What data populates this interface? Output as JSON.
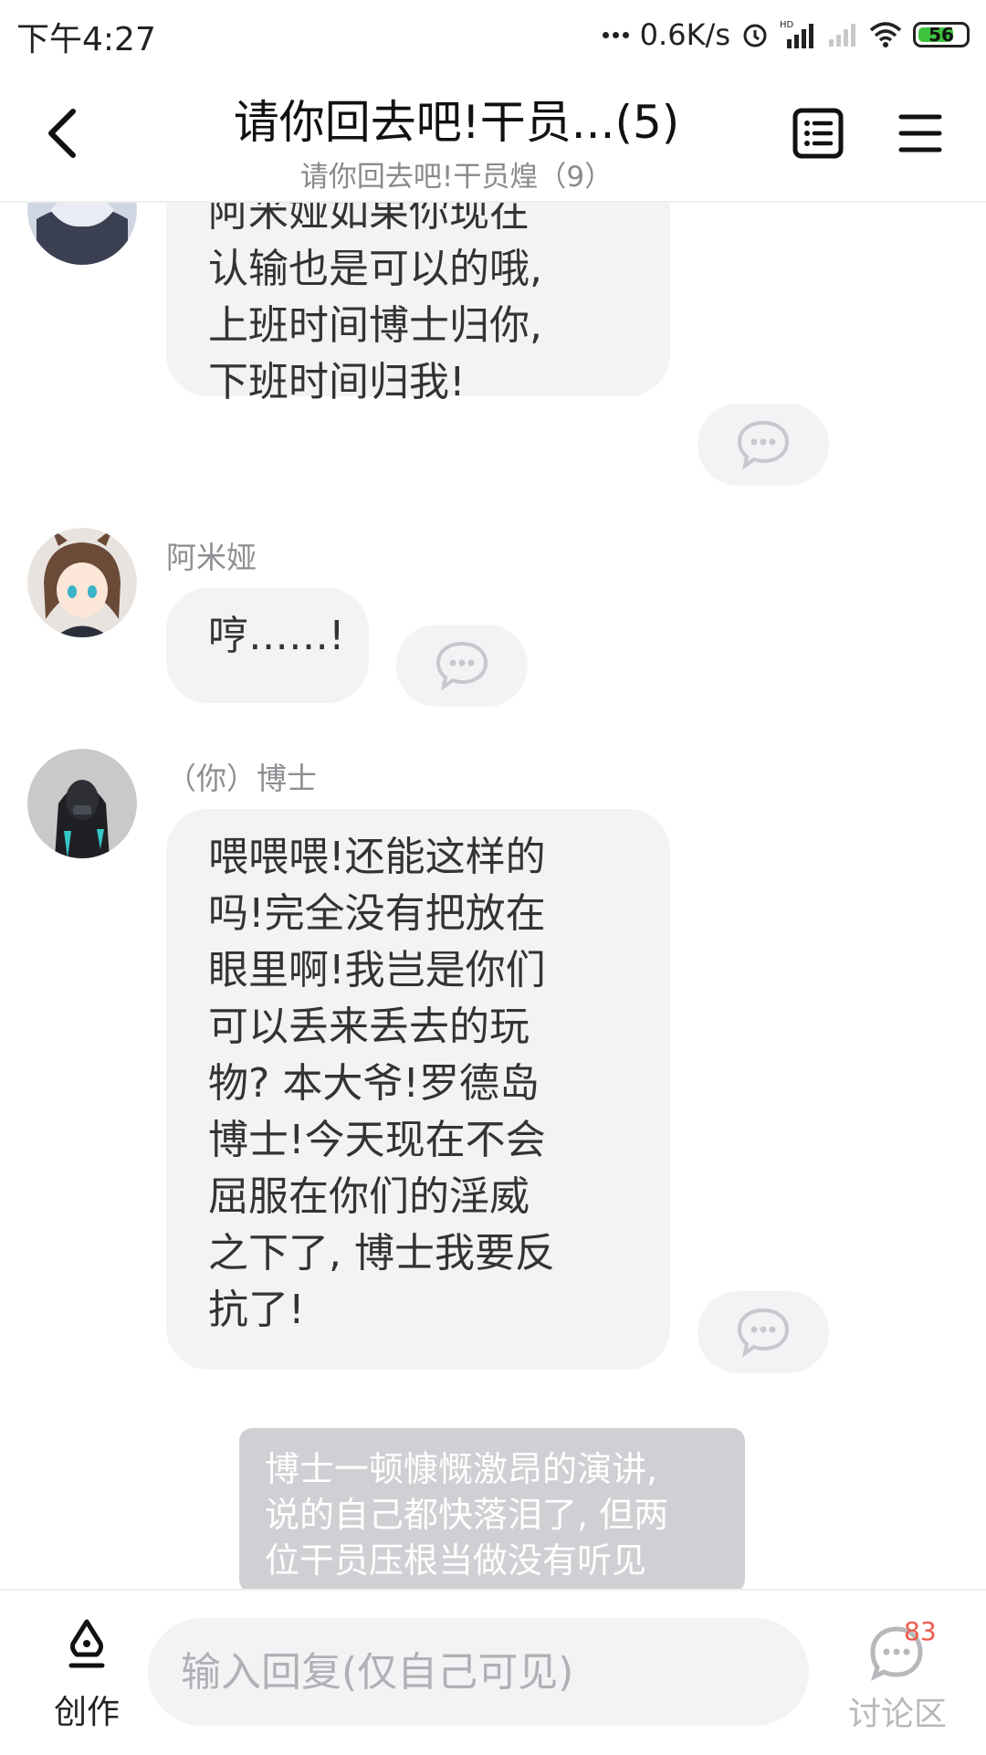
{
  "status_bar": {
    "time": "下午4:27",
    "net_speed": "0.6K/s",
    "battery": "56"
  },
  "header": {
    "title": "请你回去吧!干员...(5)",
    "subtitle": "请你回去吧!干员煌（9）"
  },
  "messages": [
    {
      "sender": "",
      "text_lines": [
        "阿米娅如果你现在",
        "认输也是可以的哦,",
        "上班时间博士归你,",
        "下班时间归我!"
      ]
    },
    {
      "sender": "阿米娅",
      "text_lines": [
        "哼……!"
      ]
    },
    {
      "sender": "（你）博士",
      "text_lines": [
        "喂喂喂!还能这样的",
        "吗!完全没有把放在",
        "眼里啊!我岂是你们",
        "可以丢来丢去的玩",
        "物? 本大爷!罗德岛",
        "博士!今天现在不会",
        "屈服在你们的淫威",
        "之下了, 博士我要反",
        "抗了!"
      ]
    }
  ],
  "narration": {
    "text_lines": [
      "博士一顿慷慨激昂的演讲,",
      "说的自己都快落泪了, 但两",
      "位干员压根当做没有听见"
    ]
  },
  "bottom_bar": {
    "create_label": "创作",
    "reply_placeholder": "输入回复(仅自己可见)",
    "discuss_label": "讨论区",
    "discuss_badge": "83"
  },
  "colors": {
    "bubble_bg": "#f3f3f5",
    "narration_bg": "#cfd0d3",
    "badge": "#f05a4a",
    "battery": "#3ec23e"
  }
}
